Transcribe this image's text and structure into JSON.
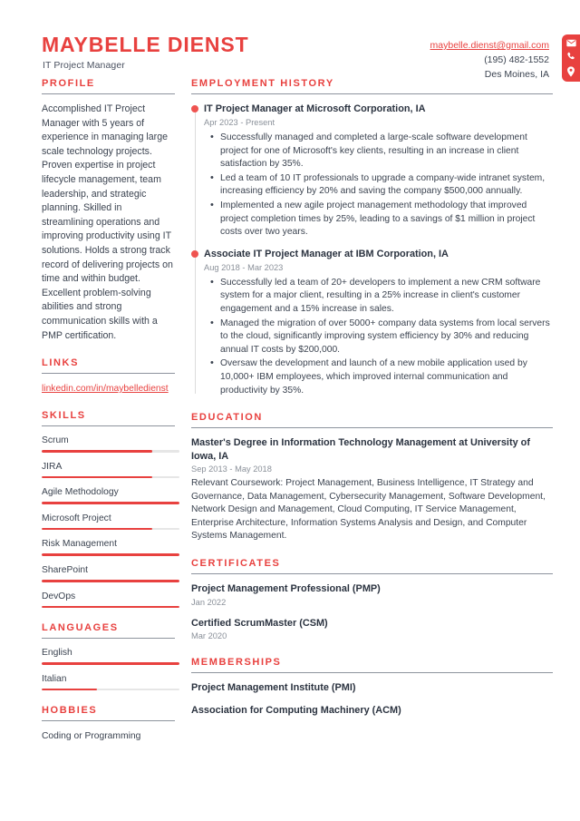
{
  "theme": {
    "accent": "#e8413f",
    "dot": "#ef5350",
    "text": "#3b4350",
    "heading_text": "#2b3340",
    "muted": "#8a9099",
    "rule": "#8d939d",
    "track": "#e6e6e6"
  },
  "header": {
    "name": "MAYBELLE DIENST",
    "job_title": "IT Project Manager",
    "contact": {
      "email": "maybelle.dienst@gmail.com",
      "phone": "(195) 482-1552",
      "location": "Des Moines, IA",
      "icons": [
        "envelope-icon",
        "phone-icon",
        "location-pin-icon"
      ]
    }
  },
  "left": {
    "profile": {
      "heading": "PROFILE",
      "text": "Accomplished IT Project Manager with 5 years of experience in managing large scale technology projects. Proven expertise in project lifecycle management, team leadership, and strategic planning. Skilled in streamlining operations and improving productivity using IT solutions. Holds a strong track record of delivering projects on time and within budget. Excellent problem-solving abilities and strong communication skills with a PMP certification."
    },
    "links": {
      "heading": "LINKS",
      "items": [
        {
          "label": "linkedin.com/in/maybelledienst"
        }
      ]
    },
    "skills": {
      "heading": "SKILLS",
      "items": [
        {
          "label": "Scrum",
          "level": 80
        },
        {
          "label": "JIRA",
          "level": 80
        },
        {
          "label": "Agile Methodology",
          "level": 100
        },
        {
          "label": "Microsoft Project",
          "level": 80
        },
        {
          "label": "Risk Management",
          "level": 100
        },
        {
          "label": "SharePoint",
          "level": 100
        },
        {
          "label": "DevOps",
          "level": 100
        }
      ]
    },
    "languages": {
      "heading": "LANGUAGES",
      "items": [
        {
          "label": "English",
          "level": 100
        },
        {
          "label": "Italian",
          "level": 40
        }
      ]
    },
    "hobbies": {
      "heading": "HOBBIES",
      "items": [
        {
          "label": "Coding or Programming"
        }
      ]
    }
  },
  "right": {
    "employment": {
      "heading": "EMPLOYMENT HISTORY",
      "jobs": [
        {
          "title": "IT Project Manager at Microsoft Corporation, IA",
          "dates": "Apr 2023 - Present",
          "bullets": [
            "Successfully managed and completed a large-scale software development project for one of Microsoft's key clients, resulting in an increase in client satisfaction by 35%.",
            "Led a team of 10 IT professionals to upgrade a company-wide intranet system, increasing efficiency by 20% and saving the company $500,000 annually.",
            "Implemented a new agile project management methodology that improved project completion times by 25%, leading to a savings of $1 million in project costs over two years."
          ]
        },
        {
          "title": "Associate IT Project Manager at IBM Corporation, IA",
          "dates": "Aug 2018 - Mar 2023",
          "bullets": [
            "Successfully led a team of 20+ developers to implement a new CRM software system for a major client, resulting in a 25% increase in client's customer engagement and a 15% increase in sales.",
            "Managed the migration of over 5000+ company data systems from local servers to the cloud, significantly improving system efficiency by 30% and reducing annual IT costs by $200,000.",
            "Oversaw the development and launch of a new mobile application used by 10,000+ IBM employees, which improved internal communication and productivity by 35%."
          ]
        }
      ]
    },
    "education": {
      "heading": "EDUCATION",
      "entries": [
        {
          "title": "Master's Degree in Information Technology Management at University of Iowa, IA",
          "dates": "Sep 2013 - May 2018",
          "description": "Relevant Coursework: Project Management, Business Intelligence, IT Strategy and Governance, Data Management, Cybersecurity Management, Software Development, Network Design and Management, Cloud Computing, IT Service Management, Enterprise Architecture, Information Systems Analysis and Design, and Computer Systems Management."
        }
      ]
    },
    "certificates": {
      "heading": "CERTIFICATES",
      "entries": [
        {
          "title": "Project Management Professional (PMP)",
          "dates": "Jan 2022"
        },
        {
          "title": "Certified ScrumMaster (CSM)",
          "dates": "Mar 2020"
        }
      ]
    },
    "memberships": {
      "heading": "MEMBERSHIPS",
      "entries": [
        {
          "title": "Project Management Institute (PMI)"
        },
        {
          "title": "Association for Computing Machinery (ACM)"
        }
      ]
    }
  }
}
